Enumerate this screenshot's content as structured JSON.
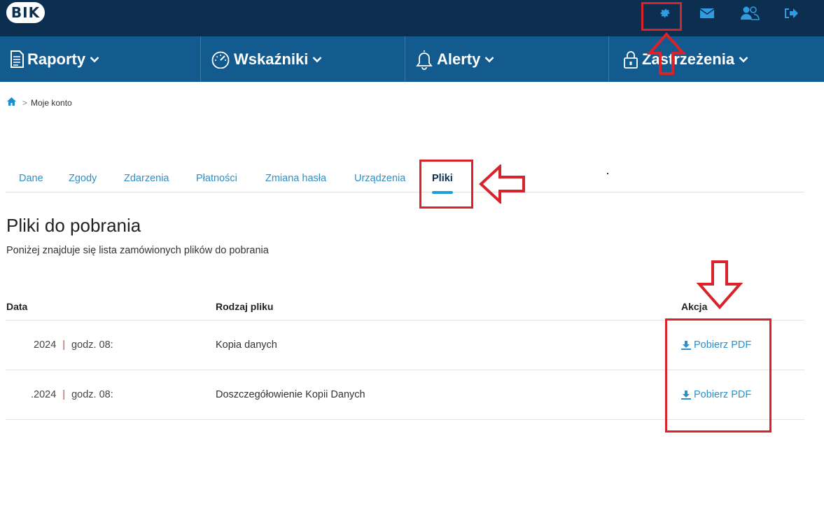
{
  "header": {
    "logo_text": "BIK",
    "icons": [
      "settings-icon",
      "mail-icon",
      "users-icon",
      "logout-icon"
    ]
  },
  "nav": {
    "items": [
      {
        "label": "Raporty",
        "icon": "report-icon"
      },
      {
        "label": "Wskaźniki",
        "icon": "gauge-icon"
      },
      {
        "label": "Alerty",
        "icon": "bell-icon"
      },
      {
        "label": "Zastrzeżenia",
        "icon": "lock-icon"
      }
    ]
  },
  "breadcrumb": {
    "separator": ">",
    "current": "Moje konto"
  },
  "tabs": [
    {
      "label": "Dane"
    },
    {
      "label": "Zgody"
    },
    {
      "label": "Zdarzenia"
    },
    {
      "label": "Płatności"
    },
    {
      "label": "Zmiana hasła"
    },
    {
      "label": "Urządzenia"
    },
    {
      "label": "Pliki",
      "active": true
    }
  ],
  "main": {
    "title": "Pliki do pobrania",
    "description": "Poniżej znajduje się lista zamówionych plików do pobrania"
  },
  "table": {
    "headers": {
      "date": "Data",
      "type": "Rodzaj pliku",
      "action": "Akcja"
    },
    "rows": [
      {
        "date": "2024",
        "time": "godz. 08:",
        "type": "Kopia danych",
        "action": "Pobierz PDF"
      },
      {
        "date": ".2024",
        "time": "godz. 08:",
        "type": "Doszczegółowienie Kopii Danych",
        "action": "Pobierz PDF"
      }
    ]
  },
  "colors": {
    "topbar": "#0d2f4f",
    "navbar": "#135b8e",
    "link": "#2f8fc6",
    "annotation": "#d8232a"
  }
}
